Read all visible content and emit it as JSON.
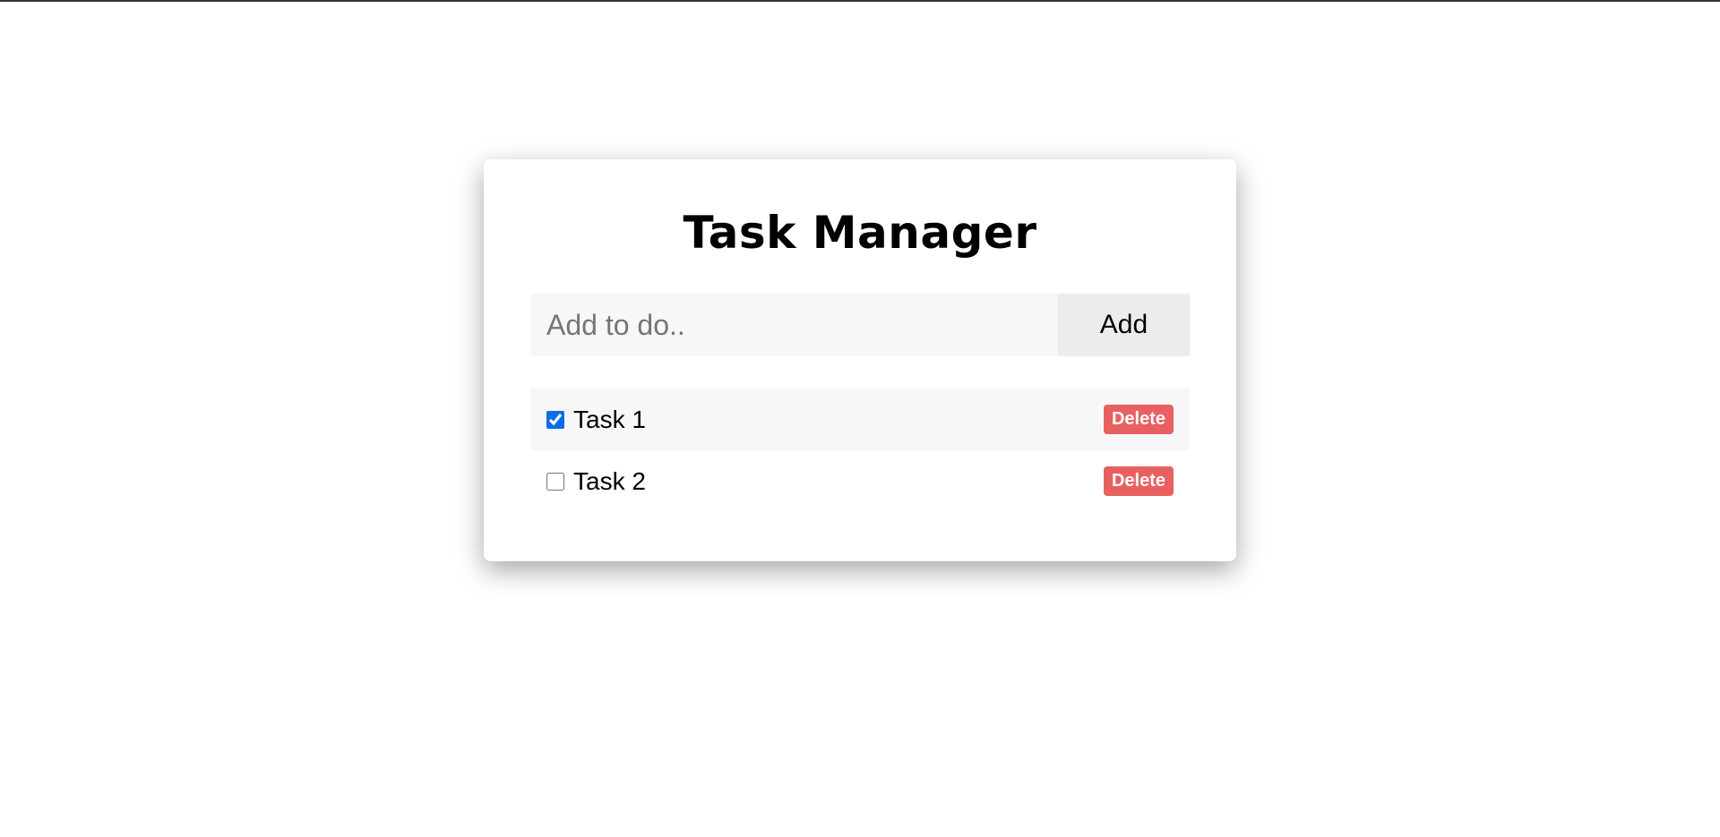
{
  "app": {
    "title": "Task Manager"
  },
  "add_form": {
    "placeholder": "Add to do..",
    "value": "",
    "button_label": "Add"
  },
  "tasks": [
    {
      "label": "Task 1",
      "completed": true,
      "delete_label": "Delete"
    },
    {
      "label": "Task 2",
      "completed": false,
      "delete_label": "Delete"
    }
  ],
  "colors": {
    "delete_button": "#e86060",
    "checkbox_accent": "#0b6ee8",
    "input_background": "#f7f7f7",
    "add_button_background": "#ececec"
  }
}
